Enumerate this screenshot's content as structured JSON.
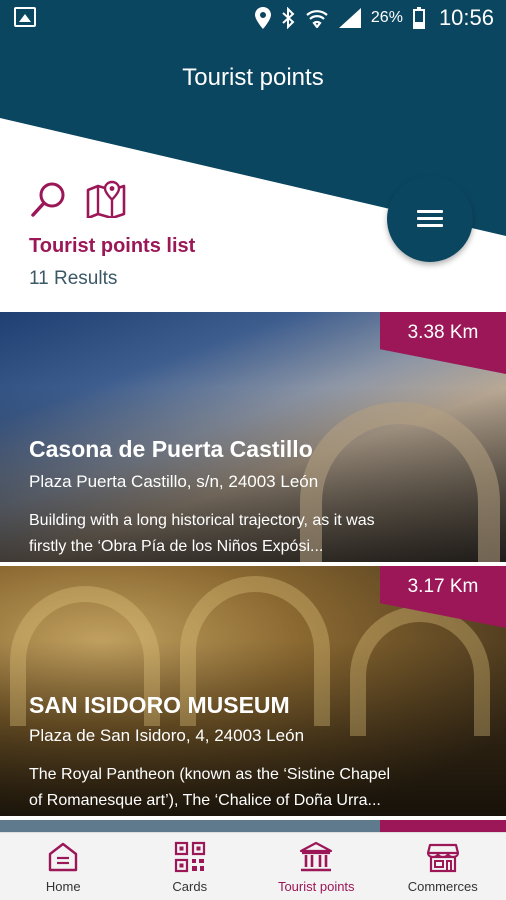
{
  "status_bar": {
    "battery": "26%",
    "time": "10:56"
  },
  "header": {
    "title": "Tourist points"
  },
  "list": {
    "title": "Tourist points list",
    "results": "11 Results"
  },
  "cards": [
    {
      "distance": "3.38 Km",
      "title": "Casona de Puerta Castillo",
      "address": "Plaza Puerta Castillo, s/n, 24003 León",
      "description_line1": "Building with a long historical trajectory, as it was",
      "description_line2": "firstly the ‘Obra Pía de los Niños Expósi..."
    },
    {
      "distance": "3.17 Km",
      "title": "SAN ISIDORO MUSEUM",
      "address": "Plaza de San Isidoro, 4, 24003 León",
      "description_line1": "The Royal Pantheon (known as the ‘Sistine Chapel",
      "description_line2": "of Romanesque art’), The ‘Chalice of Doña Urra..."
    }
  ],
  "nav": [
    {
      "label": "Home",
      "icon": "home-icon"
    },
    {
      "label": "Cards",
      "icon": "qr-code-icon"
    },
    {
      "label": "Tourist points",
      "icon": "monument-icon"
    },
    {
      "label": "Commerces",
      "icon": "store-icon"
    }
  ],
  "colors": {
    "primary": "#0b4660",
    "accent": "#9b1757"
  }
}
